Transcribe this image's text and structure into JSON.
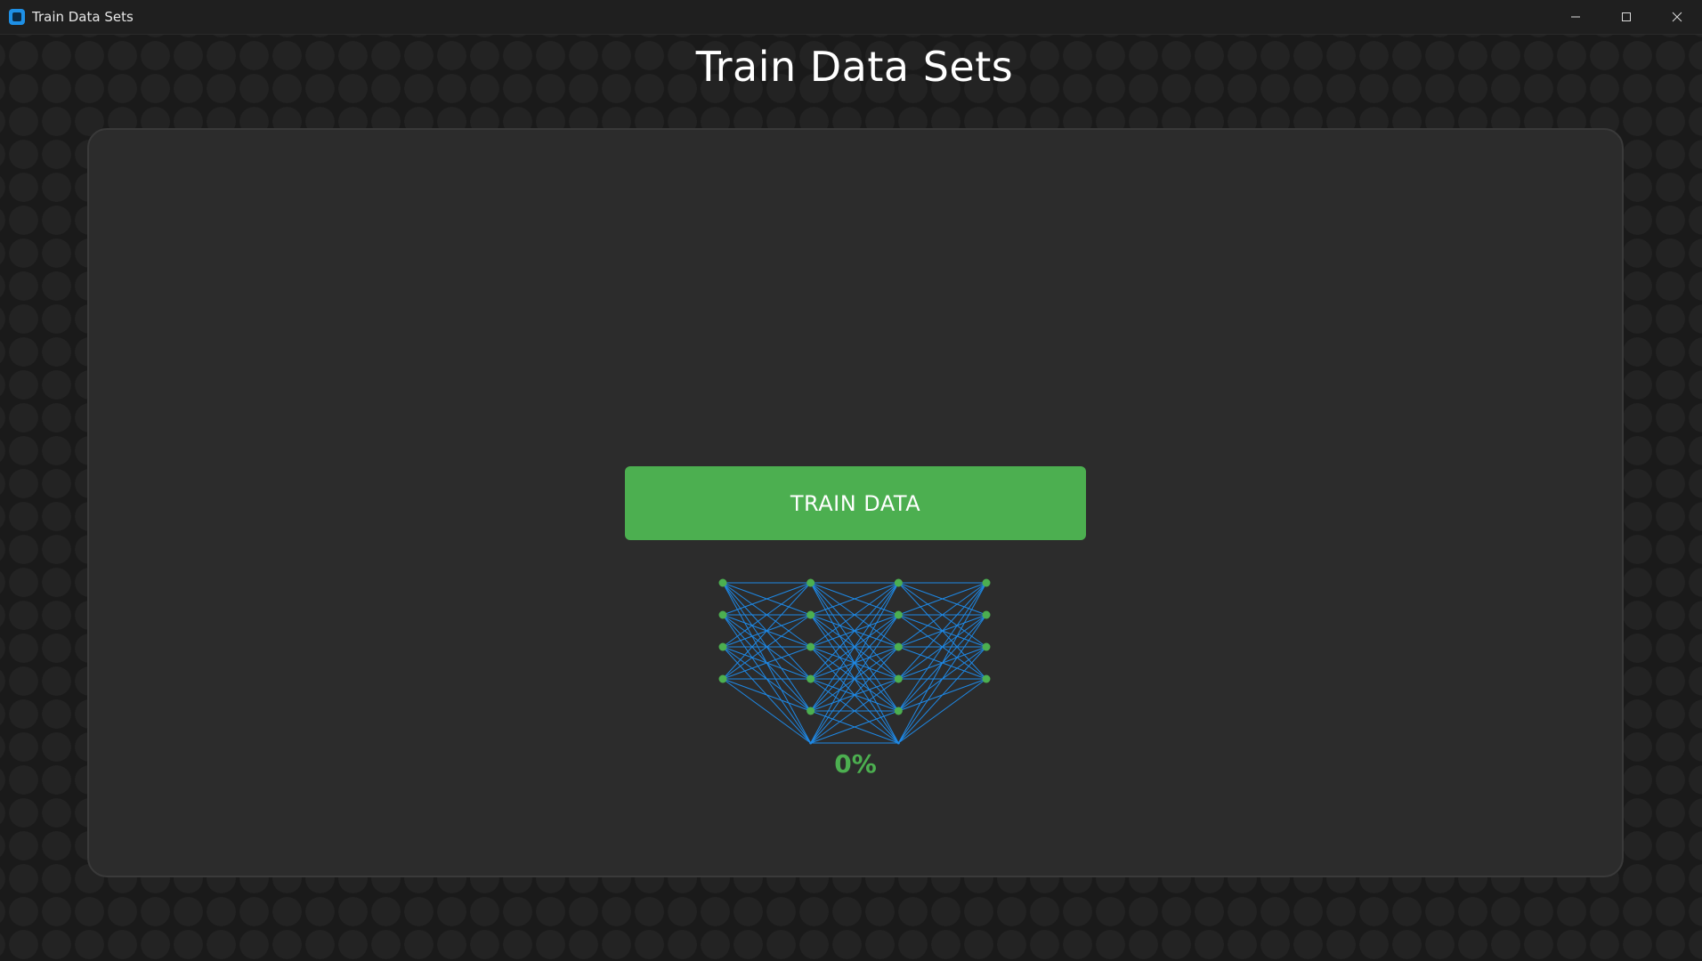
{
  "window": {
    "title": "Train Data Sets",
    "controls": [
      "minimize",
      "maximize",
      "close"
    ]
  },
  "page": {
    "title": "Train Data Sets"
  },
  "actions": {
    "train_label": "TRAIN DATA"
  },
  "progress": {
    "value": 0,
    "label": "0%"
  },
  "network": {
    "layers": [
      4,
      6,
      6,
      4
    ],
    "node_color": "#4caf50",
    "edge_color": "#1e88e5"
  },
  "colors": {
    "accent": "#4caf50",
    "card_bg": "#2c2c2c",
    "app_bg": "#1b1b1b",
    "icon_blue": "#1e90e6"
  }
}
